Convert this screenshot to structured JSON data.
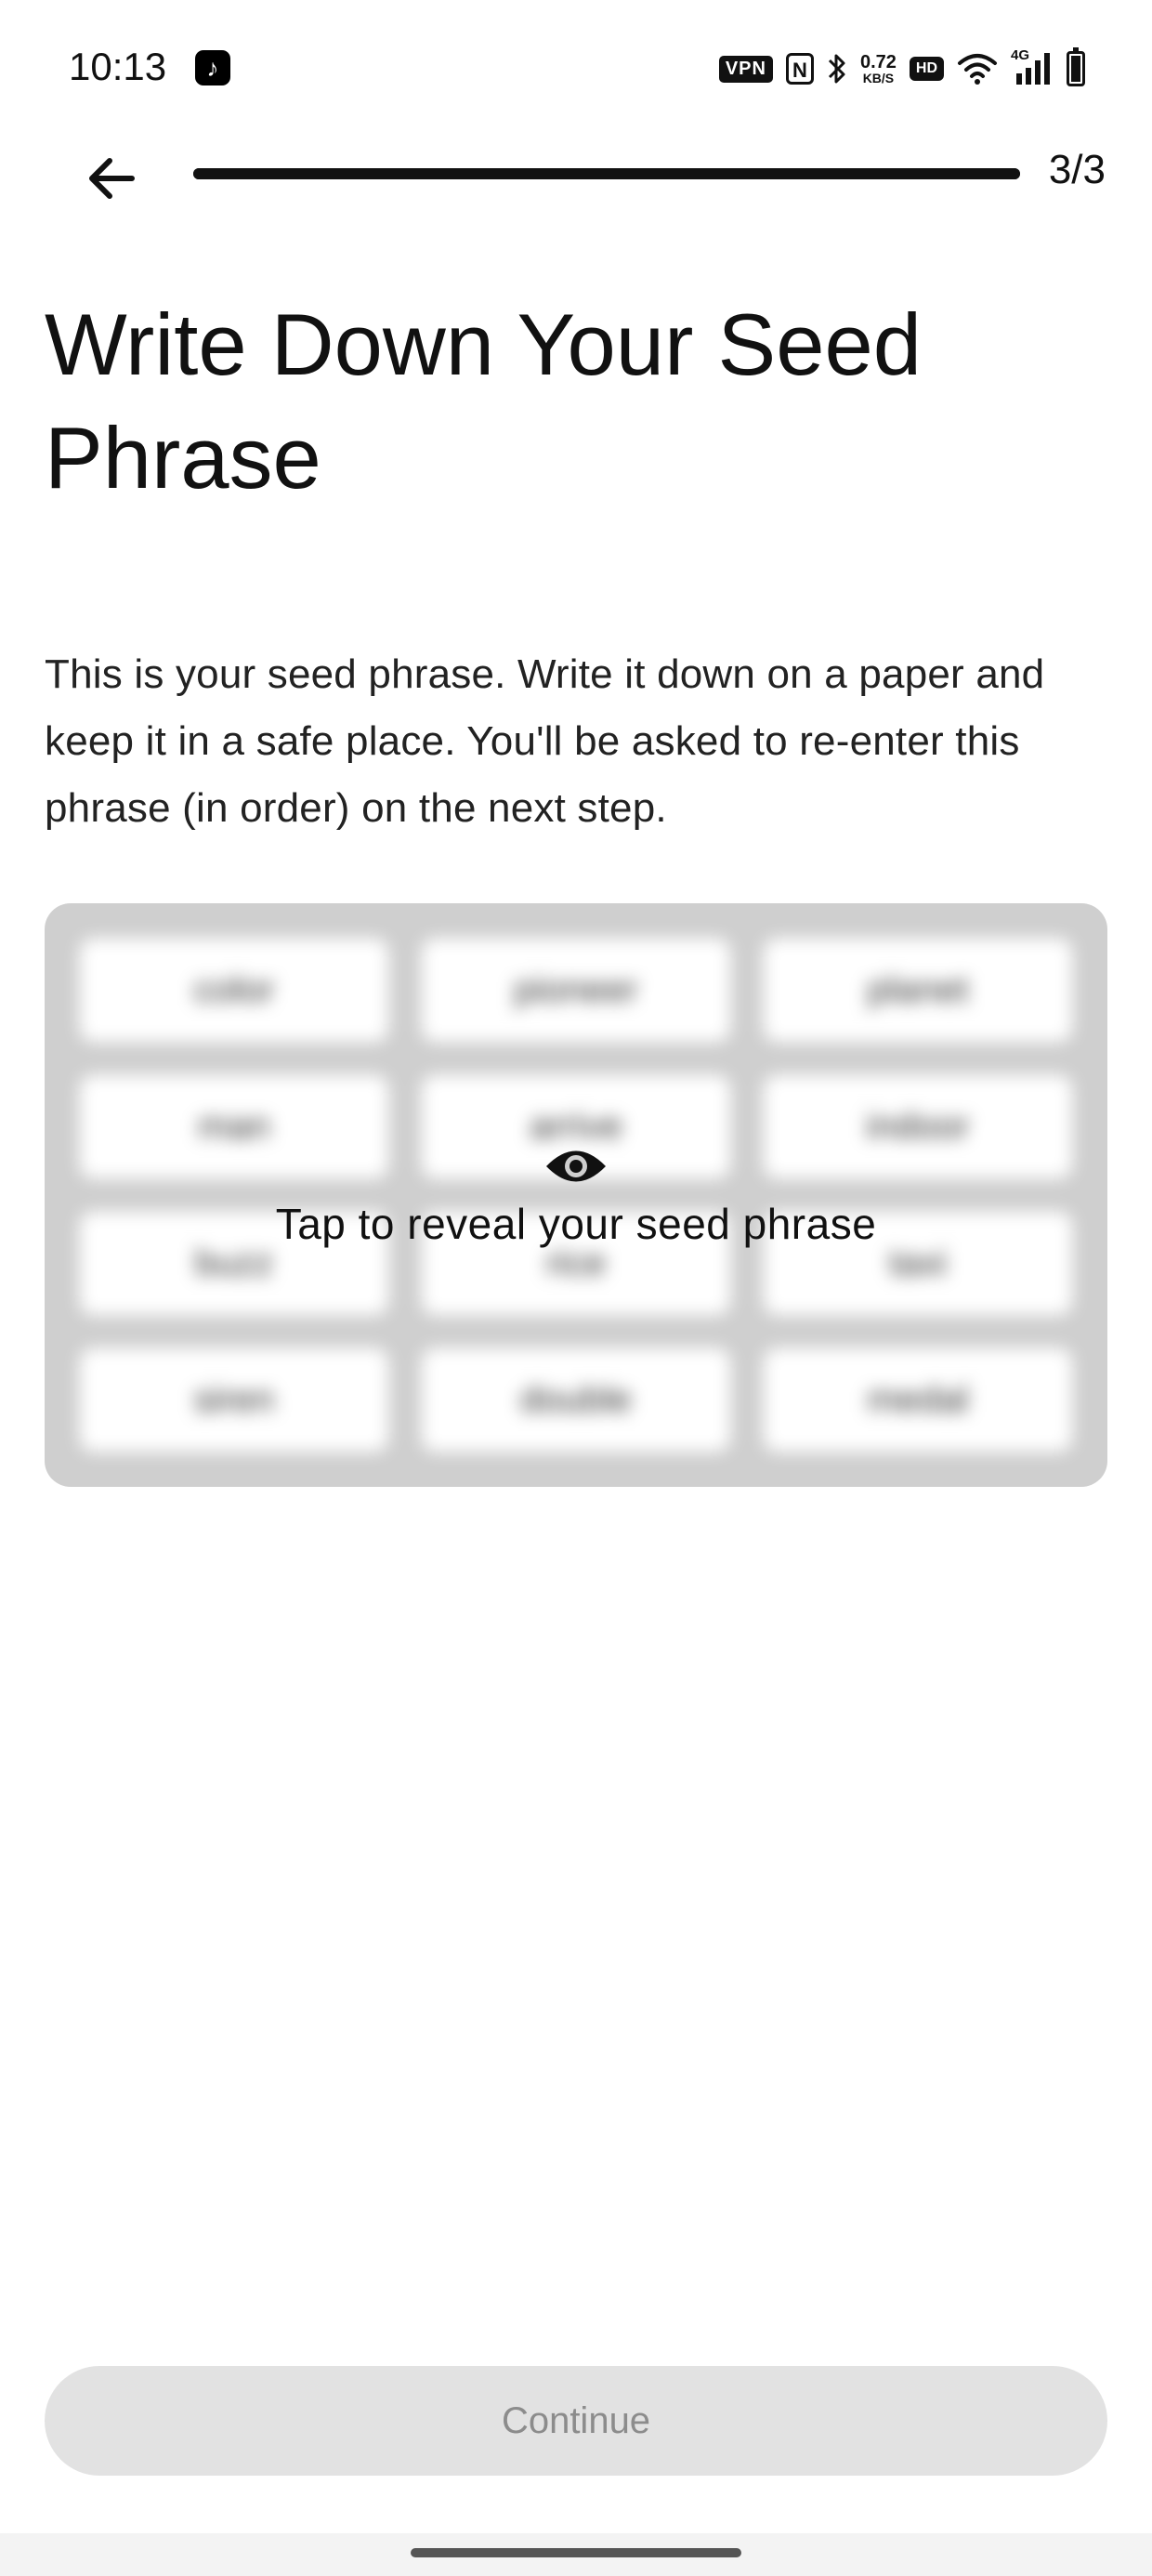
{
  "status_bar": {
    "time": "10:13",
    "app_icon": "tiktok-icon",
    "vpn_label": "VPN",
    "nfc_label": "N",
    "network_speed_value": "0.72",
    "network_speed_unit": "KB/S",
    "hd_label": "HD",
    "cellular_label": "4G",
    "icons": [
      "bluetooth-icon",
      "wifi-icon",
      "signal-icon",
      "battery-icon"
    ]
  },
  "header": {
    "back_icon": "arrow-left-icon",
    "step_counter": "3/3",
    "progress_fraction": 1.0
  },
  "page": {
    "title": "Write Down Your Seed Phrase",
    "description": "This is your seed phrase. Write it down on a paper and keep it in a safe place. You'll be asked to re-enter this phrase (in order) on the next step."
  },
  "seed_card": {
    "words": [
      "color",
      "pioneer",
      "planet",
      "man",
      "arrive",
      "indoor",
      "buzz",
      "rice",
      "taxi",
      "siren",
      "double",
      "medal"
    ],
    "reveal_icon": "eye-icon",
    "reveal_label": "Tap to reveal your seed phrase"
  },
  "footer": {
    "continue_label": "Continue"
  }
}
